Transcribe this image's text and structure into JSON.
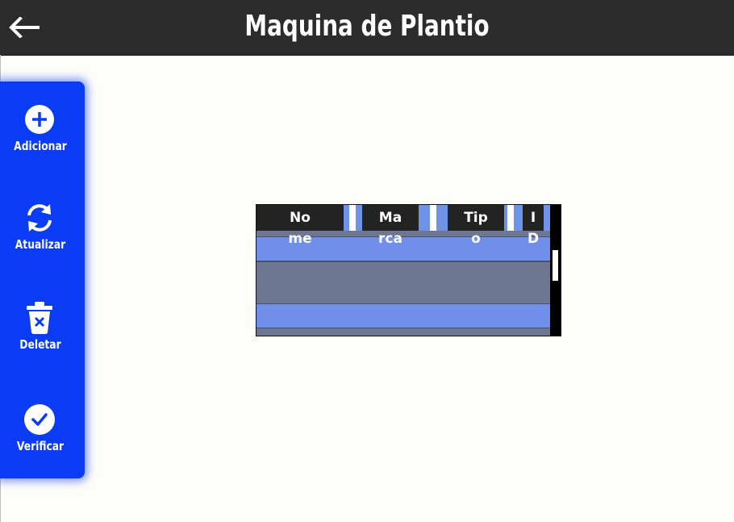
{
  "header": {
    "title": "Maquina de Plantio",
    "back_icon": "arrow-left-icon"
  },
  "sidebar": {
    "items": [
      {
        "label": "Adicionar",
        "icon": "plus-circle-icon"
      },
      {
        "label": "Atualizar",
        "icon": "refresh-icon"
      },
      {
        "label": "Deletar",
        "icon": "trash-x-icon"
      },
      {
        "label": "Verificar",
        "icon": "check-circle-icon"
      }
    ]
  },
  "table": {
    "columns": [
      {
        "line1": "No",
        "line2": "me"
      },
      {
        "line1": "Ma",
        "line2": "rca"
      },
      {
        "line1": "Tip",
        "line2": "o"
      },
      {
        "line1": "I",
        "line2": "D"
      }
    ],
    "rows": [
      [],
      [],
      []
    ]
  },
  "colors": {
    "topbar": "#2c2c2c",
    "sidebar": "#0a3cf5",
    "row_light": "#6f8fe8",
    "row_dark": "#6d7792",
    "header_cell": "#232323",
    "background": "#fdfdf9"
  }
}
